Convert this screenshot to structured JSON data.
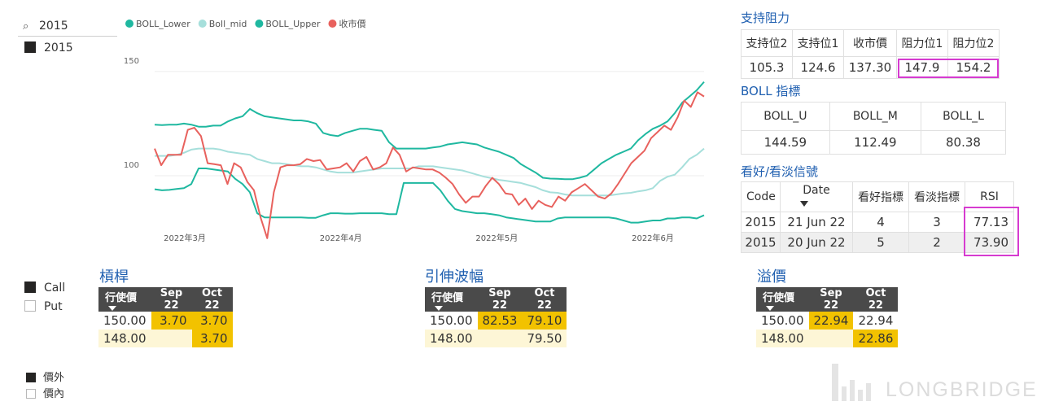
{
  "slicer": {
    "search_value": "2015",
    "items": [
      {
        "label": "2015",
        "checked": true
      }
    ]
  },
  "option_type": {
    "items": [
      {
        "label": "Call",
        "checked": true
      },
      {
        "label": "Put",
        "checked": false
      }
    ]
  },
  "moneyness": {
    "items": [
      {
        "label": "價外",
        "checked": true
      },
      {
        "label": "價內",
        "checked": false
      }
    ]
  },
  "chart_data": {
    "type": "line",
    "legend_position": "top-left",
    "ylim": [
      75,
      155
    ],
    "y_ticks": [
      100,
      150
    ],
    "x_tick_labels": [
      "2022年3月",
      "2022年4月",
      "2022年5月",
      "2022年6月"
    ],
    "grid": true,
    "series": [
      {
        "name": "BOLL_Lower",
        "color": "#1fb8a0",
        "values": [
          93.5,
          93,
          93.2,
          93.6,
          94,
          96,
          103.5,
          103.5,
          103,
          102.5,
          102,
          98.5,
          96,
          92,
          82,
          80,
          80,
          80,
          80,
          80,
          80,
          79.8,
          79.8,
          81,
          82,
          82,
          81.8,
          81.8,
          82,
          82,
          82,
          82,
          81.5,
          81.5,
          96.5,
          96.5,
          96.5,
          96.5,
          96.5,
          93,
          88,
          84,
          83,
          82.5,
          82,
          82,
          81.5,
          81,
          80,
          79.5,
          79,
          78.5,
          78,
          78,
          78,
          79.5,
          80,
          80,
          80,
          80,
          80,
          80,
          80,
          79.5,
          78.5,
          77.5,
          77.5,
          78,
          78.5,
          78.5,
          79.5,
          79.5,
          80,
          80,
          79.5,
          81
        ]
      },
      {
        "name": "Boll_mid",
        "color": "#a6dfdb",
        "values": [
          109.5,
          109.5,
          109.5,
          110,
          111,
          112.5,
          113,
          113,
          113,
          112.5,
          111.5,
          111,
          110.5,
          110,
          108,
          107,
          106,
          106,
          105.5,
          105,
          104.5,
          104.5,
          104,
          103,
          102,
          101.5,
          101.5,
          101.5,
          102,
          102.5,
          103,
          103.5,
          103.5,
          103.5,
          103.5,
          103.5,
          104.5,
          104.5,
          104.5,
          104,
          103.5,
          103,
          102.5,
          101.5,
          100.5,
          99.5,
          98.8,
          98,
          97.5,
          97,
          96.5,
          95.5,
          94.5,
          93,
          92,
          91.8,
          91,
          90.5,
          90.5,
          90.5,
          90.5,
          90.5,
          90.5,
          91,
          91.5,
          91.8,
          92.5,
          93,
          94,
          97.5,
          99.5,
          100.5,
          104,
          108,
          110,
          113
        ]
      },
      {
        "name": "BOLL_Upper",
        "color": "#1fb8a0",
        "values": [
          124.5,
          124.3,
          124.5,
          124.5,
          125,
          124.5,
          123.5,
          123.5,
          124,
          124,
          126,
          127.5,
          128.5,
          132,
          130,
          128.5,
          128,
          127.5,
          127,
          126.5,
          126.5,
          126,
          125,
          120.5,
          119.5,
          119,
          120.5,
          121.5,
          122.5,
          122.5,
          122,
          121.5,
          116,
          113,
          113,
          113,
          113,
          113,
          113.5,
          114,
          115,
          115.5,
          116,
          115.5,
          115,
          113.5,
          112.5,
          111.5,
          110,
          108.5,
          105.5,
          103.5,
          101.5,
          99,
          98.6,
          98.5,
          98.3,
          98.3,
          99,
          100,
          103,
          106,
          108,
          110,
          111.5,
          113,
          117,
          120,
          122.5,
          124,
          126,
          130,
          135,
          138,
          141,
          145
        ]
      },
      {
        "name": "收市價",
        "color": "#e8615d",
        "values": [
          113,
          105,
          110,
          110,
          110,
          122,
          123,
          119,
          106,
          105.5,
          105,
          96,
          106,
          104,
          97,
          93,
          80,
          70,
          92,
          104,
          105,
          105,
          105.5,
          108,
          107,
          107.5,
          103,
          103.5,
          104,
          106,
          102,
          107,
          109,
          103,
          104,
          106,
          113.5,
          110,
          102,
          104,
          103.5,
          103,
          103,
          101.5,
          99,
          96,
          91,
          87,
          90,
          90,
          95,
          99,
          96,
          91.5,
          91,
          86,
          89,
          84,
          88,
          86,
          85,
          90,
          88,
          92,
          94,
          96,
          93,
          90,
          89,
          91.5,
          96,
          101,
          106,
          109,
          112,
          118,
          121,
          124,
          122,
          128,
          136,
          133,
          140,
          138
        ]
      }
    ]
  },
  "support": {
    "title": "支持阻力",
    "headers": [
      "支持位2",
      "支持位1",
      "收市價",
      "阻力位1",
      "阻力位2"
    ],
    "values": [
      "105.3",
      "124.6",
      "137.30",
      "147.9",
      "154.2"
    ]
  },
  "boll": {
    "title": "BOLL 指標",
    "headers": [
      "BOLL_U",
      "BOLL_M",
      "BOLL_L"
    ],
    "values": [
      "144.59",
      "112.49",
      "80.38"
    ]
  },
  "signal": {
    "title": "看好/看淡信號",
    "headers": [
      "Code",
      "Date",
      "看好指標",
      "看淡指標",
      "RSI"
    ],
    "rows": [
      [
        "2015",
        "21 Jun 22",
        "4",
        "3",
        "77.13"
      ],
      [
        "2015",
        "20 Jun 22",
        "5",
        "2",
        "73.90"
      ]
    ]
  },
  "leverage": {
    "title": "槓桿",
    "headers": [
      "行使價",
      "Sep 22",
      "Oct 22"
    ],
    "rows": [
      [
        "150.00",
        "3.70",
        "3.70"
      ],
      [
        "148.00",
        "",
        "3.70"
      ]
    ]
  },
  "implied_vol": {
    "title": "引伸波幅",
    "headers": [
      "行使價",
      "Sep 22",
      "Oct 22"
    ],
    "rows": [
      [
        "150.00",
        "82.53",
        "79.10"
      ],
      [
        "148.00",
        "",
        "79.50"
      ]
    ]
  },
  "premium": {
    "title": "溢價",
    "headers": [
      "行使價",
      "Sep 22",
      "Oct 22"
    ],
    "rows": [
      [
        "150.00",
        "22.94",
        "22.94"
      ],
      [
        "148.00",
        "",
        "22.86"
      ]
    ]
  },
  "watermark": "LONGBRIDGE"
}
